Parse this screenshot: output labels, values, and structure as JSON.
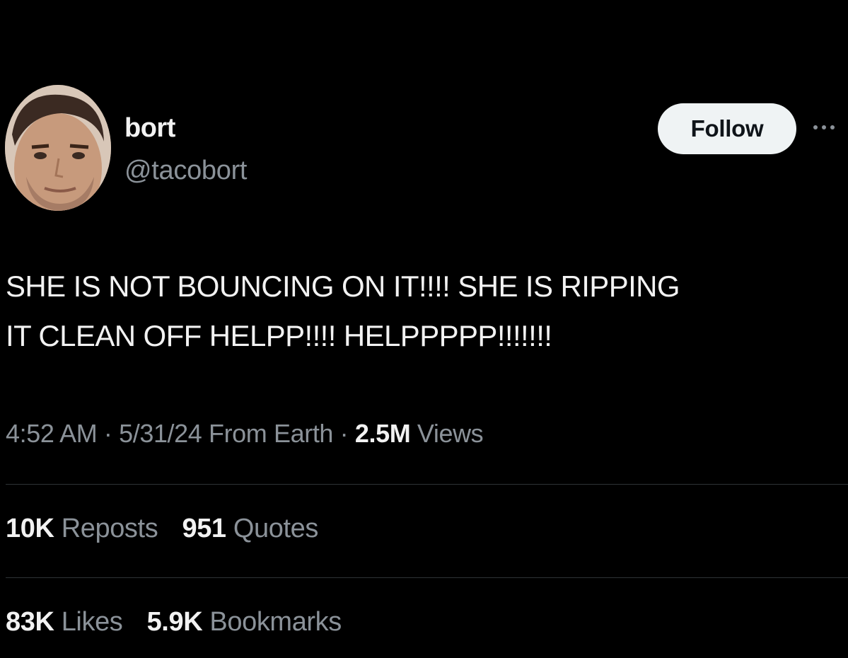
{
  "author": {
    "display_name": "bort",
    "handle": "@tacobort"
  },
  "actions": {
    "follow_label": "Follow",
    "more_icon": "more-horizontal-icon"
  },
  "tweet": {
    "text": "SHE IS NOT BOUNCING ON IT!!!! SHE IS RIPPING\nIT CLEAN OFF HELPP!!!! HELPPPPP!!!!!!!"
  },
  "meta": {
    "time": "4:52 AM",
    "sep1": " · ",
    "date": "5/31/24",
    "source": " From Earth",
    "sep2": " · ",
    "views_count": "2.5M",
    "views_label": " Views"
  },
  "stats": {
    "reposts_count": "10K",
    "reposts_label": "Reposts",
    "quotes_count": "951",
    "quotes_label": "Quotes",
    "likes_count": "83K",
    "likes_label": "Likes",
    "bookmarks_count": "5.9K",
    "bookmarks_label": "Bookmarks"
  },
  "colors": {
    "background": "#000000",
    "primary_text": "#f2f2f2",
    "secondary_text": "#8b9299",
    "button_bg": "#eff3f4",
    "divider": "#2f3336"
  }
}
